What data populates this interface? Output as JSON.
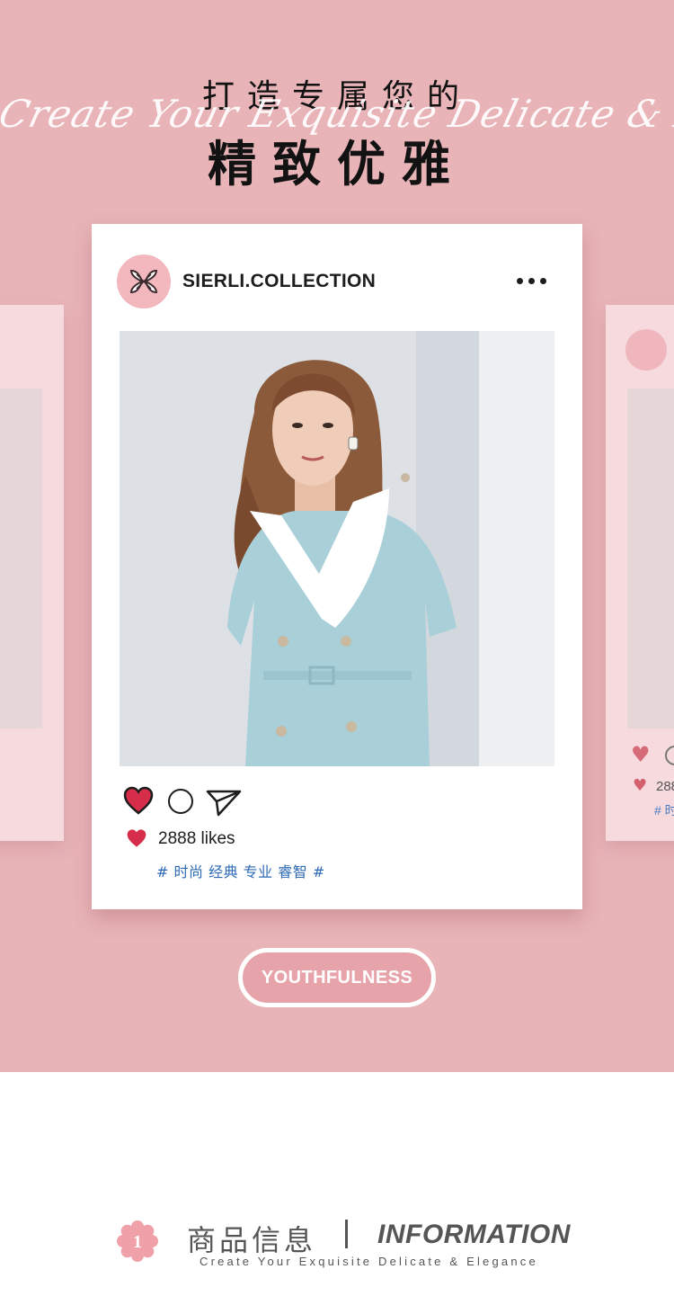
{
  "header": {
    "title_small": "打造专属您的",
    "script_line": "Create Your Exquisite Delicate & Elegance",
    "title_big": "精致优雅"
  },
  "post": {
    "handle": "SIERLI.COLLECTION",
    "likes": "2888 likes",
    "tags": "# 时尚 经典 专业 睿智 #",
    "icons": [
      "more-icon",
      "heart-icon",
      "comment-icon",
      "send-icon"
    ]
  },
  "side_card_right": {
    "likes_partial": "288",
    "tags_partial": "# 时"
  },
  "pill": {
    "label": "YOUTHFULNESS"
  },
  "info": {
    "badge_number": "1",
    "title_cn": "商品信息",
    "title_en": "INFORMATION",
    "subtitle": "Create Your Exquisite Delicate & Elegance"
  },
  "colors": {
    "hero_bg": "#e8b4b8",
    "card_bg": "#ffffff",
    "heart": "#d62e4a",
    "tag_blue": "#2e6ab4",
    "pill_bg": "#e7a3aa",
    "text_gray": "#555555"
  }
}
